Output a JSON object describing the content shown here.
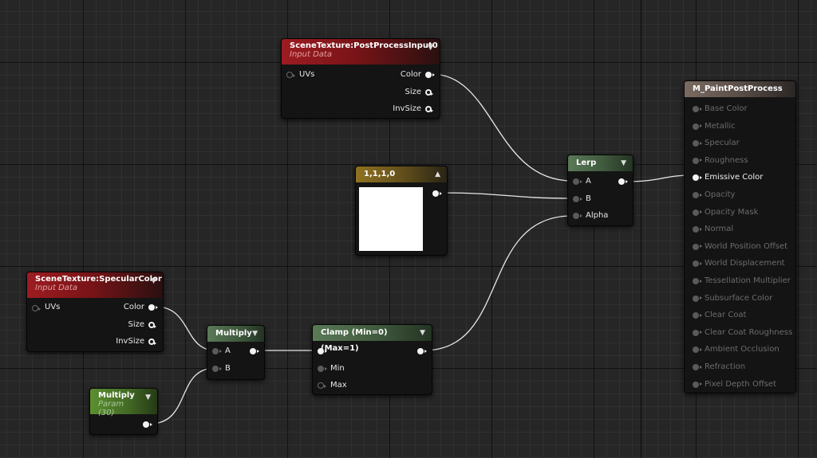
{
  "nodes": {
    "pp_input": {
      "title": "SceneTexture:PostProcessInput0",
      "subtitle": "Input Data",
      "in_uvs": "UVs",
      "out_color": "Color",
      "out_size": "Size",
      "out_invsize": "InvSize"
    },
    "spec_color": {
      "title": "SceneTexture:SpecularColor",
      "subtitle": "Input Data",
      "in_uvs": "UVs",
      "out_color": "Color",
      "out_size": "Size",
      "out_invsize": "InvSize"
    },
    "constant": {
      "title": "1,1,1,0",
      "swatch_color": "#ffffff"
    },
    "lerp": {
      "title": "Lerp",
      "in_a": "A",
      "in_b": "B",
      "in_alpha": "Alpha"
    },
    "multiply": {
      "title": "Multiply",
      "in_a": "A",
      "in_b": "B"
    },
    "param": {
      "title": "Multiply",
      "subtitle": "Param (30)"
    },
    "clamp": {
      "title": "Clamp (Min=0) (Max=1)",
      "in_min": "Min",
      "in_max": "Max"
    },
    "material": {
      "title": "M_PaintPostProcess",
      "inputs": [
        "Base Color",
        "Metallic",
        "Specular",
        "Roughness",
        "Emissive Color",
        "Opacity",
        "Opacity Mask",
        "Normal",
        "World Position Offset",
        "World Displacement",
        "Tessellation Multiplier",
        "Subsurface Color",
        "Clear Coat",
        "Clear Coat Roughness",
        "Ambient Occlusion",
        "Refraction",
        "Pixel Depth Offset"
      ],
      "active_input": "Emissive Color"
    }
  },
  "colors": {
    "wire": "#e8e8e8",
    "texture_header": "#9d1c21",
    "math_header": "#5a7a57",
    "param_header": "#5c8f30",
    "constant_header": "#8f7221",
    "material_header": "#7a6a60"
  }
}
